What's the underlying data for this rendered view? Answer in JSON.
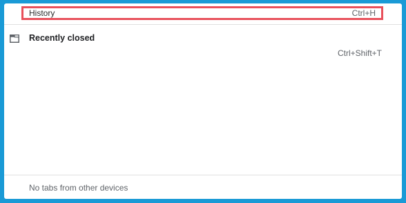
{
  "menu": {
    "history": {
      "label": "History",
      "shortcut": "Ctrl+H"
    },
    "recently_closed": {
      "title": "Recently closed",
      "icon": "tab-window-icon",
      "reopen_shortcut": "Ctrl+Shift+T"
    },
    "other_devices": {
      "text": "No tabs from other devices"
    }
  },
  "colors": {
    "border": "#1a9ad6",
    "highlight": "#e8505b",
    "background": "#ffffff"
  }
}
